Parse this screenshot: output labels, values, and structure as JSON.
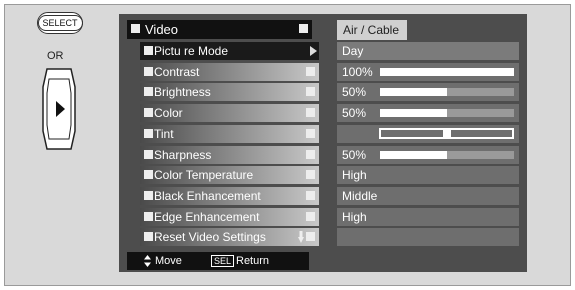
{
  "remote": {
    "select_label": "SELECT",
    "or_label": "OR",
    "nav_icon": "right-arrow-button-icon"
  },
  "osd": {
    "title": "Video",
    "input_source": "Air / Cable",
    "items": [
      {
        "label": "Pictu re Mode",
        "value": "Day",
        "selected": true
      },
      {
        "label": "Contrast",
        "value": "100%",
        "level": 100
      },
      {
        "label": "Brightness",
        "value": "50%",
        "level": 50
      },
      {
        "label": "Color",
        "value": "50%",
        "level": 50
      },
      {
        "label": "Tint",
        "value": "",
        "tint": 0
      },
      {
        "label": "Sharpness",
        "value": "50%",
        "level": 50
      },
      {
        "label": "Color  Temperature",
        "value": "High"
      },
      {
        "label": "Black Enhancement",
        "value": "Middle"
      },
      {
        "label": "Edge Enhancement",
        "value": "High"
      },
      {
        "label": "Reset Video Settings",
        "value": ""
      }
    ],
    "footer": {
      "move_label": "Move",
      "sel_key": "SEL",
      "return_label": "Return"
    }
  },
  "colors": {
    "panel": "#4d4d4d",
    "selected": "#1a1a1a",
    "value_bg": "#6e6e6e",
    "bar_fill": "#ffffff"
  }
}
